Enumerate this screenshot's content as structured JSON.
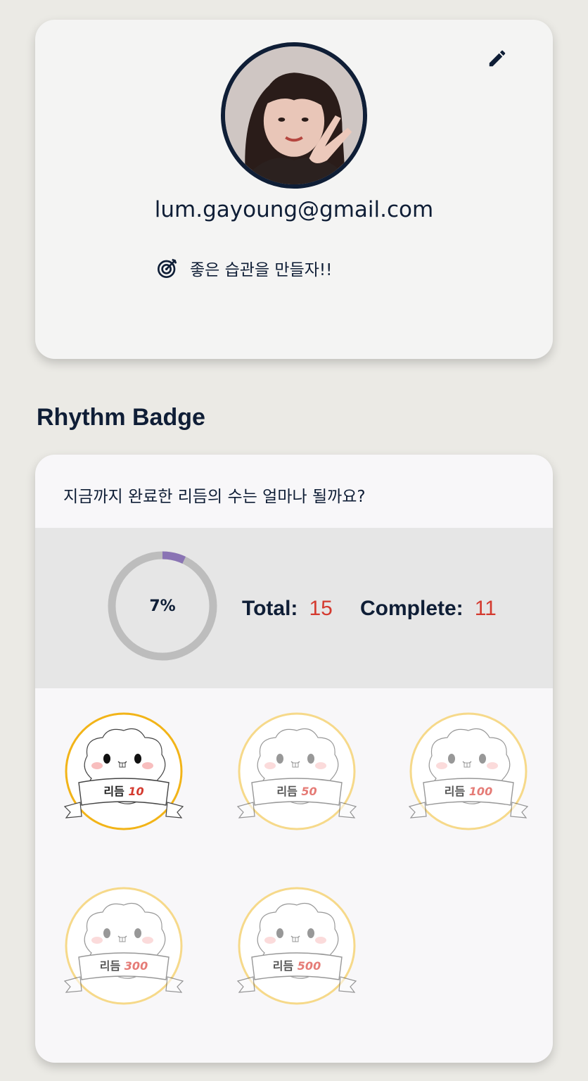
{
  "profile": {
    "email": "lum.gayoung@gmail.com",
    "goal": "좋은 습관을 만들자!!",
    "avatar_icon": "user-photo",
    "edit_icon": "pencil-icon",
    "goal_icon": "target-icon"
  },
  "section": {
    "title": "Rhythm Badge"
  },
  "stats": {
    "question": "지금까지 완료한 리듬의 수는 얼마나 될까요?",
    "percent": 7,
    "percent_label": "7%",
    "total_label": "Total:",
    "total_value": "15",
    "complete_label": "Complete:",
    "complete_value": "11"
  },
  "badges": [
    {
      "prefix": "리듬",
      "count": "10",
      "earned": true
    },
    {
      "prefix": "리듬",
      "count": "50",
      "earned": false
    },
    {
      "prefix": "리듬",
      "count": "100",
      "earned": false
    },
    {
      "prefix": "리듬",
      "count": "300",
      "earned": false
    },
    {
      "prefix": "리듬",
      "count": "500",
      "earned": false
    }
  ],
  "colors": {
    "navy": "#0f1e36",
    "accent_red": "#d43a2f",
    "progress_purple": "#8a74b4",
    "ring_gray": "#bdbdbd",
    "badge_gold": "#f2b418"
  }
}
